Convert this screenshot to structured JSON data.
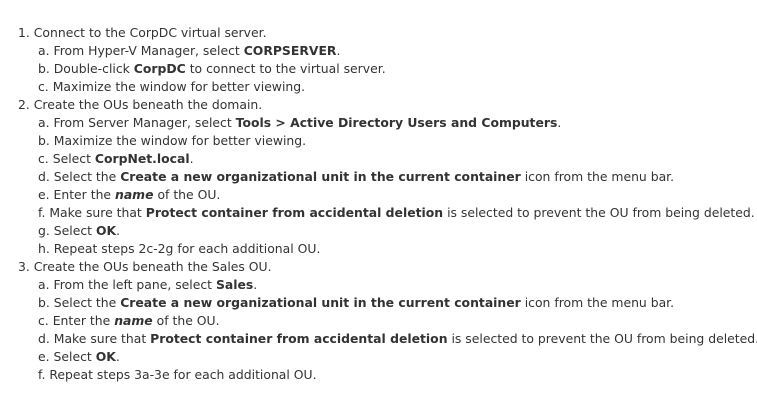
{
  "steps": [
    {
      "num": "1.",
      "text": "Connect to the CorpDC virtual server.",
      "substeps": [
        {
          "letter": "a.",
          "parts": [
            {
              "t": "From Hyper-V Manager, select ",
              "s": "n"
            },
            {
              "t": "CORPSERVER",
              "s": "b"
            },
            {
              "t": ".",
              "s": "n"
            }
          ]
        },
        {
          "letter": "b.",
          "parts": [
            {
              "t": "Double-click ",
              "s": "n"
            },
            {
              "t": "CorpDC",
              "s": "b"
            },
            {
              "t": " to connect to the virtual server.",
              "s": "n"
            }
          ]
        },
        {
          "letter": "c.",
          "parts": [
            {
              "t": "Maximize the window for better viewing.",
              "s": "n"
            }
          ]
        }
      ]
    },
    {
      "num": "2.",
      "text": "Create the OUs beneath the domain.",
      "substeps": [
        {
          "letter": "a.",
          "parts": [
            {
              "t": "From Server Manager, select ",
              "s": "n"
            },
            {
              "t": "Tools > Active Directory Users and Computers",
              "s": "b"
            },
            {
              "t": ".",
              "s": "n"
            }
          ]
        },
        {
          "letter": "b.",
          "parts": [
            {
              "t": "Maximize the window for better viewing.",
              "s": "n"
            }
          ]
        },
        {
          "letter": "c.",
          "parts": [
            {
              "t": "Select ",
              "s": "n"
            },
            {
              "t": "CorpNet.local",
              "s": "b"
            },
            {
              "t": ".",
              "s": "n"
            }
          ]
        },
        {
          "letter": "d.",
          "parts": [
            {
              "t": "Select the ",
              "s": "n"
            },
            {
              "t": "Create a new organizational unit in the current container",
              "s": "b"
            },
            {
              "t": " icon from the menu bar.",
              "s": "n"
            }
          ]
        },
        {
          "letter": "e.",
          "parts": [
            {
              "t": "Enter the ",
              "s": "n"
            },
            {
              "t": "name",
              "s": "bi"
            },
            {
              "t": " of the OU.",
              "s": "n"
            }
          ]
        },
        {
          "letter": "f.",
          "parts": [
            {
              "t": "Make sure that ",
              "s": "n"
            },
            {
              "t": "Protect container from accidental deletion",
              "s": "b"
            },
            {
              "t": " is selected to prevent the OU from being deleted.",
              "s": "n"
            }
          ]
        },
        {
          "letter": "g.",
          "parts": [
            {
              "t": "Select ",
              "s": "n"
            },
            {
              "t": "OK",
              "s": "b"
            },
            {
              "t": ".",
              "s": "n"
            }
          ]
        },
        {
          "letter": "h.",
          "parts": [
            {
              "t": "Repeat steps 2c-2g for each additional OU.",
              "s": "n"
            }
          ]
        }
      ]
    },
    {
      "num": "3.",
      "text": "Create the OUs beneath the Sales OU.",
      "substeps": [
        {
          "letter": "a.",
          "parts": [
            {
              "t": "From the left pane, select ",
              "s": "n"
            },
            {
              "t": "Sales",
              "s": "b"
            },
            {
              "t": ".",
              "s": "n"
            }
          ]
        },
        {
          "letter": "b.",
          "parts": [
            {
              "t": "Select the ",
              "s": "n"
            },
            {
              "t": "Create a new organizational unit in the current container",
              "s": "b"
            },
            {
              "t": " icon from the menu bar.",
              "s": "n"
            }
          ]
        },
        {
          "letter": "c.",
          "parts": [
            {
              "t": "Enter the ",
              "s": "n"
            },
            {
              "t": "name",
              "s": "bi"
            },
            {
              "t": " of the OU.",
              "s": "n"
            }
          ]
        },
        {
          "letter": "d.",
          "parts": [
            {
              "t": "Make sure that ",
              "s": "n"
            },
            {
              "t": "Protect container from accidental deletion",
              "s": "b"
            },
            {
              "t": " is selected to prevent the OU from being deleted.",
              "s": "n"
            }
          ]
        },
        {
          "letter": "e.",
          "parts": [
            {
              "t": "Select ",
              "s": "n"
            },
            {
              "t": "OK",
              "s": "b"
            },
            {
              "t": ".",
              "s": "n"
            }
          ]
        },
        {
          "letter": "f.",
          "parts": [
            {
              "t": "Repeat steps 3a-3e for each additional OU.",
              "s": "n"
            }
          ]
        }
      ]
    }
  ]
}
